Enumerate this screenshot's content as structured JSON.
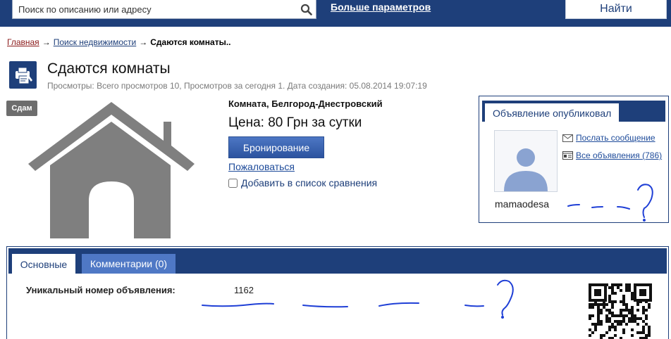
{
  "header": {
    "search_placeholder": "Поиск по описанию или адресу",
    "more_params_label": "Больше параметров",
    "find_button_label": "Найти"
  },
  "breadcrumb": {
    "home": "Главная",
    "search": "Поиск недвижимости",
    "separator": "→",
    "current": "Сдаются комнаты.."
  },
  "listing": {
    "title": "Сдаются комнаты",
    "stats": "Просмотры: Всего просмотров 10, Просмотров за сегодня 1.   Дата создания: 05.08.2014 19:07:19",
    "badge": "Сдам",
    "room_location": "Комната, Белгород-Днестровский",
    "price": "Цена: 80 Грн за сутки",
    "booking_button_label": "Бронирование",
    "complain_link_label": "Пожаловаться",
    "compare_label": "Добавить в список сравнения"
  },
  "publisher": {
    "heading": "Объявление опубликовал",
    "username": "mamaodesa",
    "send_message_label": "Послать сообщение",
    "all_listings_label": "Все объявления (786)"
  },
  "tabs": [
    {
      "label": "Основные"
    },
    {
      "label": "Комментарии (0)"
    }
  ],
  "details": {
    "unique_number_label": "Уникальный номер объявления:",
    "unique_number_value": "1162"
  },
  "icons": {
    "search": "search-icon",
    "title": "listing-icon",
    "envelope": "envelope-icon",
    "listings": "listings-icon",
    "house": "house-image",
    "qr": "qr-code"
  },
  "colors": {
    "brand": "#1e3f7a",
    "button": "#3a63b0",
    "inactive_tab": "#4f78c5",
    "scribble": "#1f3fd6"
  }
}
